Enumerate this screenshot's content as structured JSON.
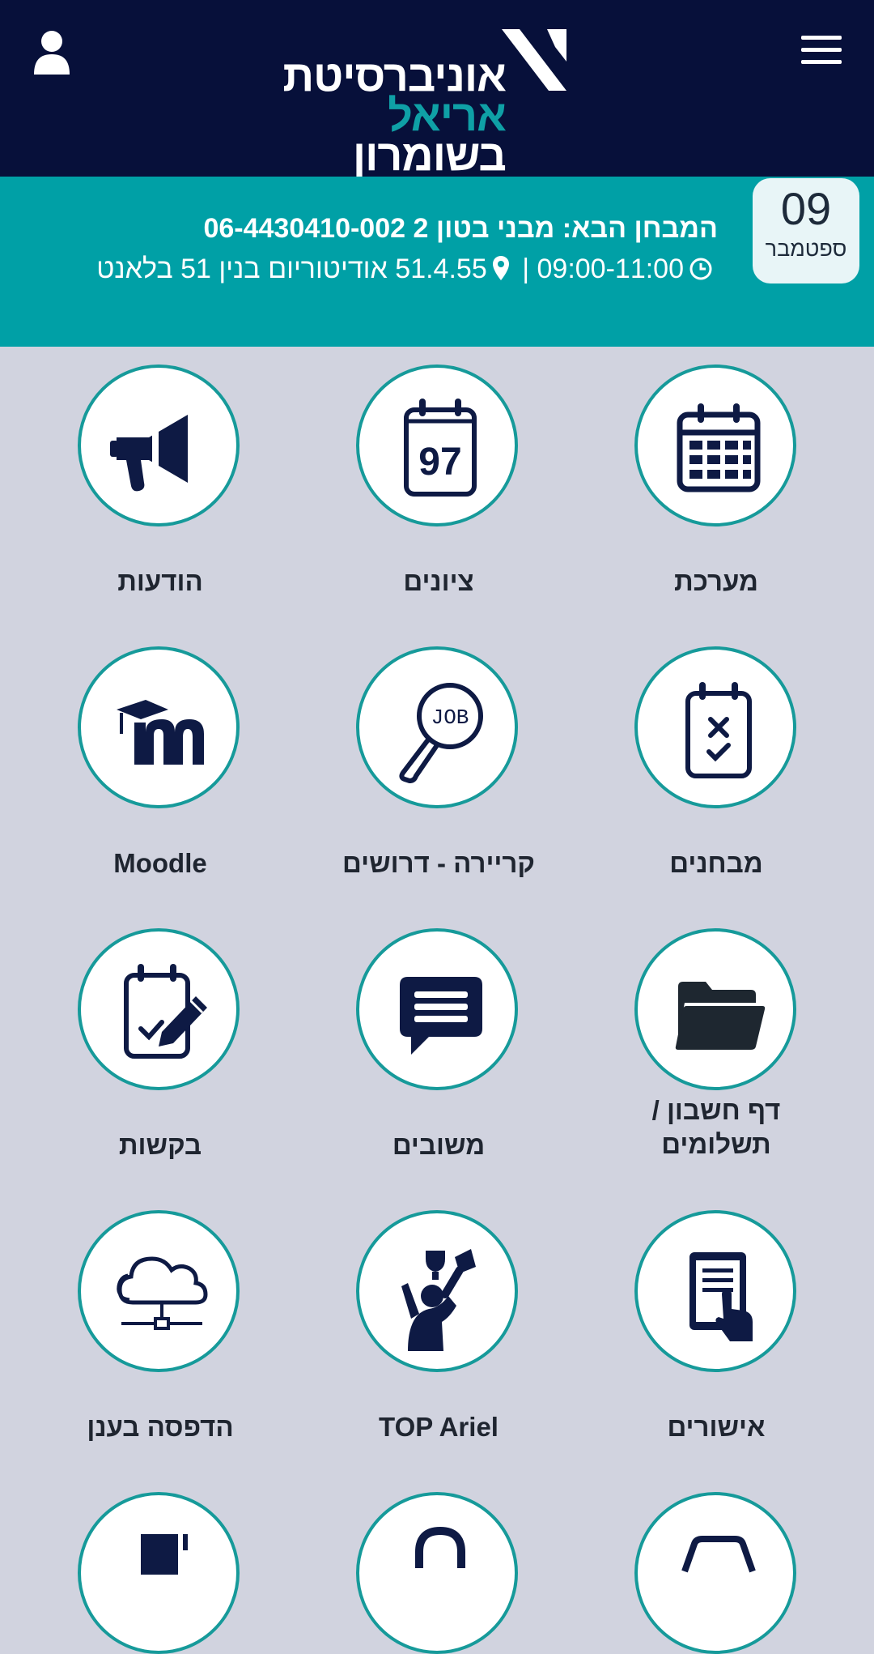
{
  "header": {
    "logo_line1": "אוניברסיטת",
    "logo_line2": "אריאל",
    "logo_line3": "בשומרון",
    "user_icon": "user-icon",
    "menu_icon": "hamburger-menu-icon"
  },
  "next_exam": {
    "day": "09",
    "month": "ספטמבר",
    "title": "המבחן הבא: מבני בטון 2 06-4430410-002",
    "time": "09:00-11:00",
    "location": "51.4.55 אודיטוריום בנין 51 בלאנט",
    "separator": "|"
  },
  "tiles": [
    {
      "label": "מערכת",
      "icon": "calendar-icon"
    },
    {
      "label": "ציונים",
      "icon": "grades-97-icon",
      "icon_text": "97"
    },
    {
      "label": "הודעות",
      "icon": "megaphone-icon"
    },
    {
      "label": "מבחנים",
      "icon": "exam-clipboard-icon"
    },
    {
      "label": "קריירה - דרושים",
      "icon": "job-search-icon",
      "icon_text": "JOB"
    },
    {
      "label": "Moodle",
      "icon": "moodle-icon"
    },
    {
      "label": "דף חשבון / תשלומים",
      "icon": "folder-icon"
    },
    {
      "label": "משובים",
      "icon": "chat-bubble-icon"
    },
    {
      "label": "בקשות",
      "icon": "request-form-icon"
    },
    {
      "label": "אישורים",
      "icon": "document-touch-icon"
    },
    {
      "label": "TOP Ariel",
      "icon": "trophy-winner-icon"
    },
    {
      "label": "הדפסה בענן",
      "icon": "cloud-print-icon"
    }
  ],
  "colors": {
    "header_bg": "#07103a",
    "banner_bg": "#00a0a6",
    "page_bg": "#d1d3df",
    "icon_color": "#0e1a44",
    "circle_border": "#169a9a"
  }
}
